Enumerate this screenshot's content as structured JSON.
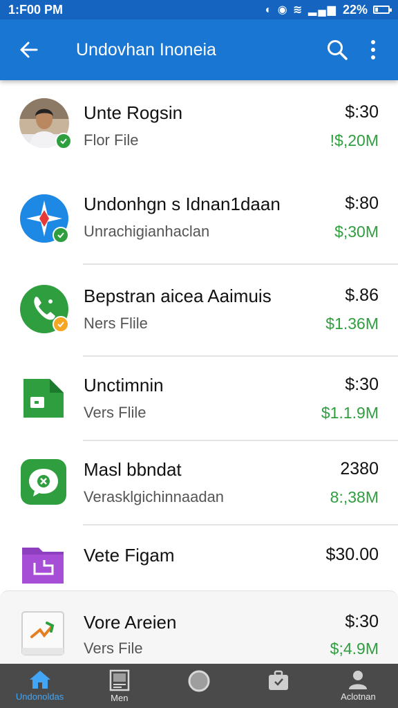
{
  "status_bar": {
    "time": "1:F00 PM",
    "battery": "22%",
    "battery_level": 0.22
  },
  "app_bar": {
    "title": "Undovhan Inoneia"
  },
  "list": [
    {
      "title": "Unte Rogsin",
      "subtitle": "Flor File",
      "price": "$:30",
      "size": "!$,20M",
      "icon": "user-avatar",
      "badge_color": "#2e9e3e"
    },
    {
      "title": "Undonhgn s Idnan1daan",
      "subtitle": "Unrachigianhaclan",
      "price": "$:80",
      "size": "$;30M",
      "icon": "compass-app-icon",
      "badge_color": "#2e9e3e"
    },
    {
      "title": "Bepstran aicea Aaimuis",
      "subtitle": "Ners Flile",
      "price": "$.86",
      "size": "$1.36M",
      "icon": "phone-app-icon",
      "badge_color": "#f5a623"
    },
    {
      "title": "Unctimnin",
      "subtitle": "Vers Flile",
      "price": "$:30",
      "size": "$1.1.9M",
      "icon": "green-file-icon"
    },
    {
      "title": "Masl bbndat",
      "subtitle": "Verasklgichinnaadan",
      "price": "2380",
      "size": "8:,38M",
      "icon": "chat-app-icon"
    },
    {
      "title": "Vete Figam",
      "subtitle": "",
      "price": "$30.00",
      "size": "",
      "icon": "purple-folder-icon"
    },
    {
      "title": "Vore Areien",
      "subtitle": "Vers File",
      "price": "$:30",
      "size": "$;4.9M",
      "icon": "whiteboard-app-icon"
    }
  ],
  "bottom_nav": [
    {
      "label": "Undonoldas",
      "icon": "home-icon",
      "active": true
    },
    {
      "label": "Men",
      "icon": "document-icon",
      "active": false
    },
    {
      "label": "",
      "icon": "circle-icon",
      "active": false
    },
    {
      "label": "",
      "icon": "briefcase-icon",
      "active": false
    },
    {
      "label": "Aclotnan",
      "icon": "person-icon",
      "active": false
    }
  ],
  "colors": {
    "app_bar": "#1976d2",
    "status_bar": "#1565c0",
    "size_text": "#2e9e3e",
    "nav_active": "#42a5f5"
  }
}
